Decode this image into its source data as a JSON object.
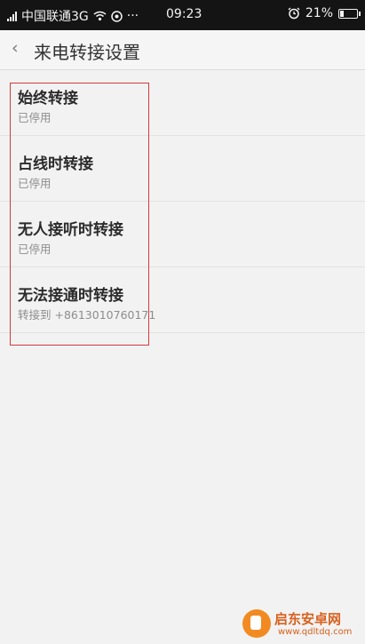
{
  "status_bar": {
    "carrier": "中国联通3G",
    "more": "···",
    "time": "09:23",
    "battery_percent": "21%",
    "battery_level": 0.21
  },
  "header": {
    "back": "‹",
    "title": "来电转接设置"
  },
  "forwarding": [
    {
      "title": "始终转接",
      "status": "已停用"
    },
    {
      "title": "占线时转接",
      "status": "已停用"
    },
    {
      "title": "无人接听时转接",
      "status": "已停用"
    },
    {
      "title": "无法接通时转接",
      "status": "转接到 +8613010760171"
    }
  ],
  "watermark": {
    "name": "启东安卓网",
    "url": "www.qdltdq.com"
  },
  "colors": {
    "highlight_border": "#d23a3a",
    "watermark": "#d9601d"
  }
}
